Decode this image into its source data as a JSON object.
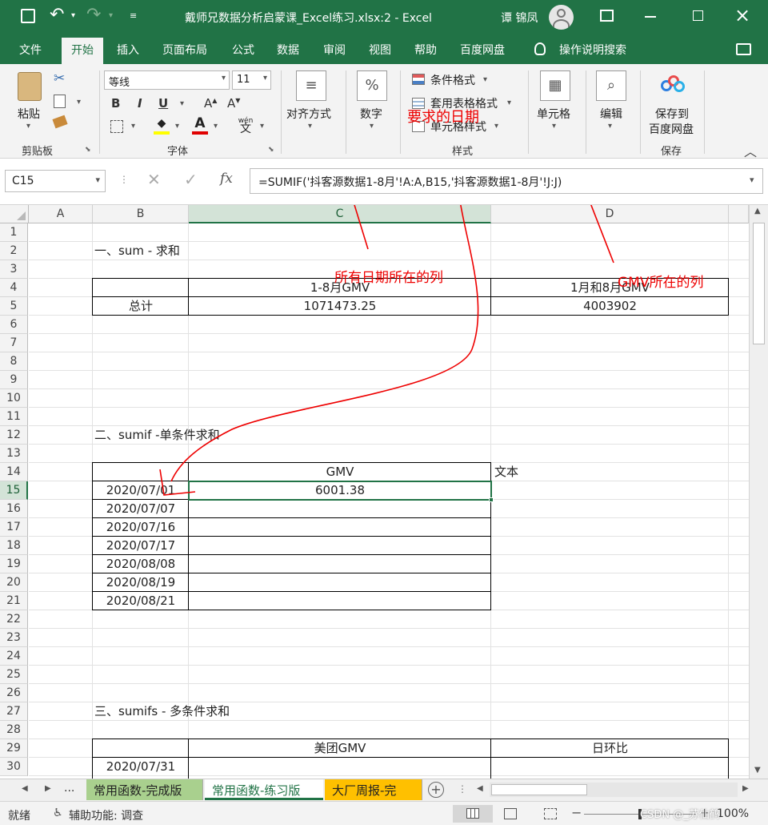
{
  "window": {
    "title": "戴师兄数据分析启蒙课_Excel练习.xlsx:2  -  Excel",
    "user": "谭 锦凤"
  },
  "tabs": [
    "文件",
    "开始",
    "插入",
    "页面布局",
    "公式",
    "数据",
    "审阅",
    "视图",
    "帮助",
    "百度网盘"
  ],
  "active_tab": "开始",
  "tell_me": "操作说明搜索",
  "ribbon": {
    "paste_label": "粘贴",
    "clipboard_group": "剪贴板",
    "font_name": "等线",
    "font_size": "11",
    "font_group": "字体",
    "align_label": "对齐方式",
    "number_label": "数字",
    "cond_format": "条件格式",
    "table_format": "套用表格格式",
    "cell_style": "单元格样式",
    "styles_group": "样式",
    "cells_label": "单元格",
    "edit_label": "编辑",
    "save_label_1": "保存到",
    "save_label_2": "百度网盘",
    "save_group": "保存",
    "wen_icon": "wén"
  },
  "formula_bar": {
    "name_box": "C15",
    "formula": "=SUMIF('抖客源数据1-8月'!A:A,B15,'抖客源数据1-8月'!J:J)"
  },
  "columns": [
    "A",
    "B",
    "C",
    "D"
  ],
  "rows": [
    "1",
    "2",
    "3",
    "4",
    "5",
    "6",
    "7",
    "8",
    "9",
    "10",
    "11",
    "12",
    "13",
    "14",
    "15",
    "16",
    "17",
    "18",
    "19",
    "20",
    "21",
    "22",
    "23",
    "24",
    "25",
    "26",
    "27",
    "28",
    "29",
    "30"
  ],
  "cells": {
    "b2": "一、sum - 求和",
    "c4": "1-8月GMV",
    "d4": "1月和8月GMV",
    "b5": "总计",
    "c5": "1071473.25",
    "d5": "4003902",
    "b12": "二、sumif -单条件求和",
    "c14": "GMV",
    "d14": "文本",
    "dates": [
      "2020/07/01",
      "2020/07/07",
      "2020/07/16",
      "2020/07/17",
      "2020/08/08",
      "2020/08/19",
      "2020/08/21"
    ],
    "c15": "6001.38",
    "b27": "三、sumifs - 多条件求和",
    "c29": "美团GMV",
    "d29": "日环比",
    "b30": "2020/07/31"
  },
  "annotations": {
    "date_needed": "要求的日期",
    "date_column": "所有日期所在的列",
    "gmv_column": "GMV所在的列"
  },
  "sheets": [
    {
      "label": "常用函数-完成版"
    },
    {
      "label": "常用函数-练习版"
    },
    {
      "label": "大厂周报-完"
    }
  ],
  "sheet_nav_more": "...",
  "status": {
    "mode": "就绪",
    "accessibility": "辅助功能: 调查",
    "zoom": "100%",
    "watermark": "CSDN @_苏仙鹤"
  },
  "colors": {
    "accent": "#217346",
    "annotation": "#ee0000",
    "sheet_done": "#a9d08e",
    "sheet_weekly": "#ffc000"
  }
}
